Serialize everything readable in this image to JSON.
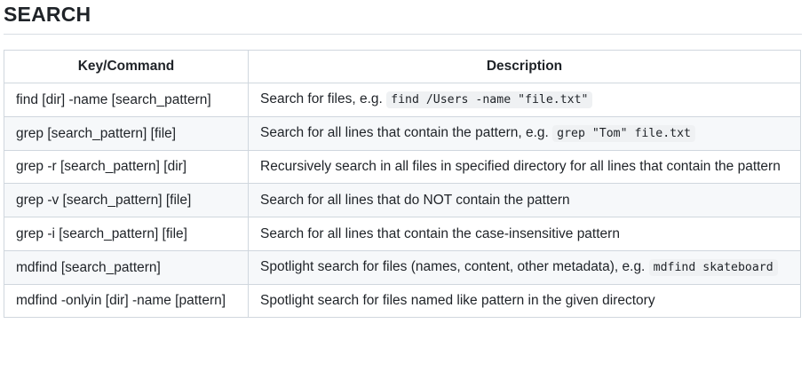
{
  "heading": "SEARCH",
  "table": {
    "headers": [
      "Key/Command",
      "Description"
    ],
    "rows": [
      {
        "command": "find [dir] -name [search_pattern]",
        "text": "Search for files, e.g. ",
        "code": "find /Users -name \"file.txt\""
      },
      {
        "command": "grep [search_pattern] [file]",
        "text": "Search for all lines that contain the pattern, e.g. ",
        "code": "grep \"Tom\" file.txt"
      },
      {
        "command": "grep -r [search_pattern] [dir]",
        "text": "Recursively search in all files in specified directory for all lines that contain the pattern",
        "code": ""
      },
      {
        "command": "grep -v [search_pattern] [file]",
        "text": "Search for all lines that do NOT contain the pattern",
        "code": ""
      },
      {
        "command": "grep -i [search_pattern] [file]",
        "text": "Search for all lines that contain the case-insensitive pattern",
        "code": ""
      },
      {
        "command": "mdfind [search_pattern]",
        "text": "Spotlight search for files (names, content, other metadata), e.g. ",
        "code": "mdfind skateboard"
      },
      {
        "command": "mdfind -onlyin [dir] -name [pattern]",
        "text": "Spotlight search for files named like pattern in the given directory",
        "code": ""
      }
    ]
  }
}
